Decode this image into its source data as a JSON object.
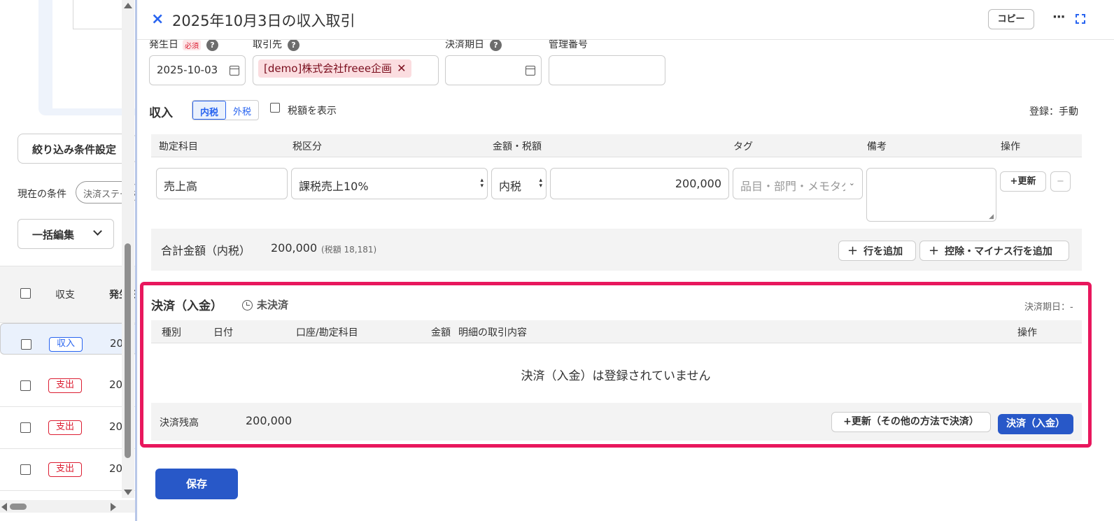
{
  "left": {
    "filter_button": "絞り込み条件設定",
    "condition_label": "現在の条件",
    "condition_chip": "決済ステータス",
    "bulk_edit": "一括編集",
    "list_header": [
      "収支",
      "発生日"
    ],
    "rows": [
      {
        "type": "収入",
        "kind": "in",
        "date": "20"
      },
      {
        "type": "支出",
        "kind": "out",
        "date": "20"
      },
      {
        "type": "支出",
        "kind": "out",
        "date": "20"
      },
      {
        "type": "支出",
        "kind": "out",
        "date": "20"
      }
    ]
  },
  "header": {
    "title": "2025年10月3日の収入取引",
    "copy": "コピー"
  },
  "fields": {
    "date_label": "発生日",
    "required": "必須",
    "date_value": "2025-10-03",
    "partner_label": "取引先",
    "partner_chip": "[demo]株式会社freee企画",
    "due_label": "決済期日",
    "mgmt_label": "管理番号"
  },
  "income": {
    "title": "収入",
    "seg_in": "内税",
    "seg_out": "外税",
    "show_tax": "税額を表示",
    "registered": "登録：手動",
    "columns": [
      "勘定科目",
      "税区分",
      "金額・税額",
      "タグ",
      "備考",
      "操作"
    ],
    "row": {
      "account": "売上高",
      "tax": "課税売上10%",
      "tax_mode": "内税",
      "amount": "200,000",
      "tag_placeholder": "品目・部門・メモタグ",
      "update": "+更新",
      "minus": "−"
    },
    "total_label": "合計金額（内税）",
    "total_value": "200,000",
    "total_tax": "(税額 18,181)",
    "add_row": "行を追加",
    "add_minus_row": "控除・マイナス行を追加"
  },
  "payment": {
    "title": "決済（入金）",
    "status": "未決済",
    "due": "決済期日：-",
    "columns": [
      "種別",
      "日付",
      "口座/勘定科目",
      "金額",
      "明細の取引内容",
      "操作"
    ],
    "empty": "決済（入金）は登録されていません",
    "balance_label": "決済残高",
    "balance_value": "200,000",
    "other_method": "+更新（その他の方法で決済）",
    "pay_button": "決済（入金）"
  },
  "save": "保存"
}
